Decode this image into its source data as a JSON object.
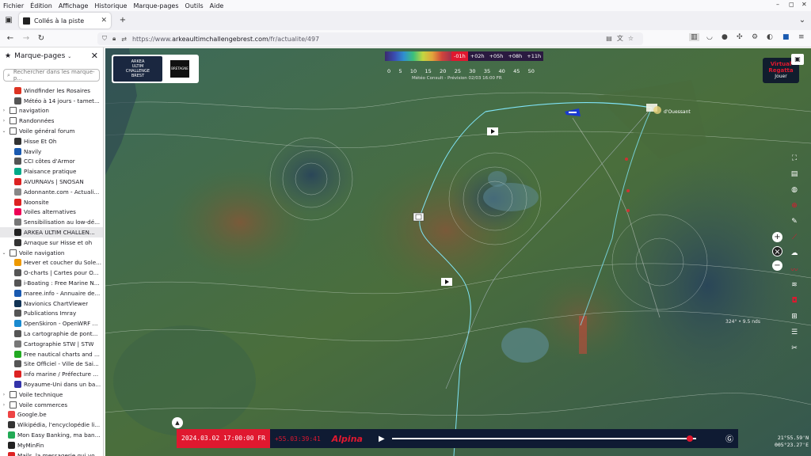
{
  "menubar": {
    "items": [
      "Fichier",
      "Édition",
      "Affichage",
      "Historique",
      "Marque-pages",
      "Outils",
      "Aide"
    ]
  },
  "tab": {
    "title": "Collés à la piste"
  },
  "address": {
    "prefix": "https://www.",
    "domain": "arkeaultimchallengebrest.com",
    "path": "/fr/actualite/497"
  },
  "sidebar": {
    "title": "Marque-pages",
    "search_placeholder": "Rechercher dans les marque-p...",
    "items": [
      {
        "label": "Windfinder les Rosaires",
        "level": 2,
        "type": "link",
        "icon": "windfinder-icon",
        "color": "#d32"
      },
      {
        "label": "Météo à 14 jours - tamet...",
        "level": 2,
        "type": "link",
        "icon": "globe-icon",
        "color": "#555"
      },
      {
        "label": "navigation",
        "level": 1,
        "type": "folder",
        "expanded": false
      },
      {
        "label": "Randonnées",
        "level": 1,
        "type": "folder",
        "expanded": false
      },
      {
        "label": "Voile général forum",
        "level": 1,
        "type": "folder",
        "expanded": true
      },
      {
        "label": "Hisse Et Oh",
        "level": 2,
        "type": "link",
        "icon": "hisse-icon",
        "color": "#333"
      },
      {
        "label": "Navily",
        "level": 2,
        "type": "link",
        "icon": "navily-icon",
        "color": "#1a5ab0"
      },
      {
        "label": "CCI côtes d'Armor",
        "level": 2,
        "type": "link",
        "icon": "cci-icon",
        "color": "#555"
      },
      {
        "label": "Plaisance pratique",
        "level": 2,
        "type": "link",
        "icon": "plaisance-icon",
        "color": "#0a8"
      },
      {
        "label": "AVURNAVs | SNOSAN",
        "level": 2,
        "type": "link",
        "icon": "avurnav-icon",
        "color": "#d22"
      },
      {
        "label": "Adonnante.com - Actuali...",
        "level": 2,
        "type": "link",
        "icon": "adonnante-icon",
        "color": "#888"
      },
      {
        "label": "Noonsite",
        "level": 2,
        "type": "link",
        "icon": "noonsite-icon",
        "color": "#d22"
      },
      {
        "label": "Voiles alternatives",
        "level": 2,
        "type": "link",
        "icon": "voiles-icon",
        "color": "#e05"
      },
      {
        "label": "Sensibilisation au low-dé...",
        "level": 2,
        "type": "link",
        "icon": "lowdesign-icon",
        "color": "#777"
      },
      {
        "label": "ARKEA ULTIM CHALLEN...",
        "level": 2,
        "type": "link",
        "icon": "arkea-icon",
        "color": "#222",
        "selected": true
      },
      {
        "label": "Arnaque sur Hisse et oh",
        "level": 2,
        "type": "link",
        "icon": "hisse-icon",
        "color": "#333"
      },
      {
        "label": "Voile navigation",
        "level": 1,
        "type": "folder",
        "expanded": true
      },
      {
        "label": "Hever et coucher du Sole...",
        "level": 2,
        "type": "link",
        "icon": "sun-icon",
        "color": "#e90"
      },
      {
        "label": "O-charts | Cartes pour O...",
        "level": 2,
        "type": "link",
        "icon": "ocharts-icon",
        "color": "#555"
      },
      {
        "label": "i-Boating : Free Marine N...",
        "level": 2,
        "type": "link",
        "icon": "iboating-icon",
        "color": "#555"
      },
      {
        "label": "maree.info - Annuaire de...",
        "level": 2,
        "type": "link",
        "icon": "maree-icon",
        "color": "#1a5ab0"
      },
      {
        "label": "Navionics ChartViewer",
        "level": 2,
        "type": "link",
        "icon": "navionics-icon",
        "color": "#135"
      },
      {
        "label": "Publications Imray",
        "level": 2,
        "type": "link",
        "icon": "globe-icon",
        "color": "#555"
      },
      {
        "label": "OpenSkiron - OpenWRF ...",
        "level": 2,
        "type": "link",
        "icon": "openskiron-icon",
        "color": "#1a8ad0"
      },
      {
        "label": "La cartographie de pont...",
        "level": 2,
        "type": "link",
        "icon": "carto-icon",
        "color": "#555"
      },
      {
        "label": "Cartographie STW | STW",
        "level": 2,
        "type": "link",
        "icon": "stw-icon",
        "color": "#777"
      },
      {
        "label": "Free nautical charts and ...",
        "level": 2,
        "type": "link",
        "icon": "charts-icon",
        "color": "#2a2"
      },
      {
        "label": "Site Officiel - Ville de Sai...",
        "level": 2,
        "type": "link",
        "icon": "ville-icon",
        "color": "#555"
      },
      {
        "label": "info marine / Préfecture ...",
        "level": 2,
        "type": "link",
        "icon": "prefecture-icon",
        "color": "#d22"
      },
      {
        "label": "Royaume-Uni dans un ba...",
        "level": 2,
        "type": "link",
        "icon": "flag-icon",
        "color": "#33a"
      },
      {
        "label": "Voile technique",
        "level": 1,
        "type": "folder",
        "expanded": false
      },
      {
        "label": "Voile commerces",
        "level": 1,
        "type": "folder",
        "expanded": false
      },
      {
        "label": "Google.be",
        "level": 1,
        "type": "link",
        "icon": "google-icon",
        "color": "#e44"
      },
      {
        "label": "Wikipédia, l'encyclopédie li...",
        "level": 1,
        "type": "link",
        "icon": "wikipedia-icon",
        "color": "#333"
      },
      {
        "label": "Mon Easy Banking, ma banq...",
        "level": 1,
        "type": "link",
        "icon": "bank-icon",
        "color": "#2a5"
      },
      {
        "label": "MyMinFin",
        "level": 1,
        "type": "link",
        "icon": "minfin-icon",
        "color": "#222"
      },
      {
        "label": "Mails, la messagerie qui vo...",
        "level": 1,
        "type": "link",
        "icon": "mail-icon",
        "color": "#d22"
      }
    ]
  },
  "map": {
    "logo": {
      "text1": "ARKEA",
      "text2": "ULTIM",
      "text3": "CHALLENGE",
      "text4": "BREST",
      "partner": "BRETAGNE"
    },
    "legend": {
      "times": [
        "-01h",
        "+02h",
        "+05h",
        "+08h",
        "+11h"
      ],
      "active_time": "-01h",
      "scale": [
        "0",
        "5",
        "10",
        "15",
        "20",
        "25",
        "30",
        "35",
        "40",
        "45",
        "50"
      ],
      "caption": "Météo Consult - Prévision 02/03 16:00 FR"
    },
    "virtual_regatta": {
      "line1": "Virtual",
      "line2": "Regatta",
      "line3": "Jouer"
    },
    "boat_label": "d'Ouessant",
    "wind_readout": "324° • 9.5 nds",
    "coords": {
      "lat": "21°55.59'N",
      "lon": "005°23.27'E"
    }
  },
  "timeline": {
    "date": "2024.03.02 17:00:00 FR",
    "elapsed": "+55.03:39:41",
    "brand": "Alpina",
    "progress": 0.98
  },
  "colors": {
    "accent": "#e0182f",
    "navy": "#0f1b33",
    "track": "#5fd3e8"
  }
}
